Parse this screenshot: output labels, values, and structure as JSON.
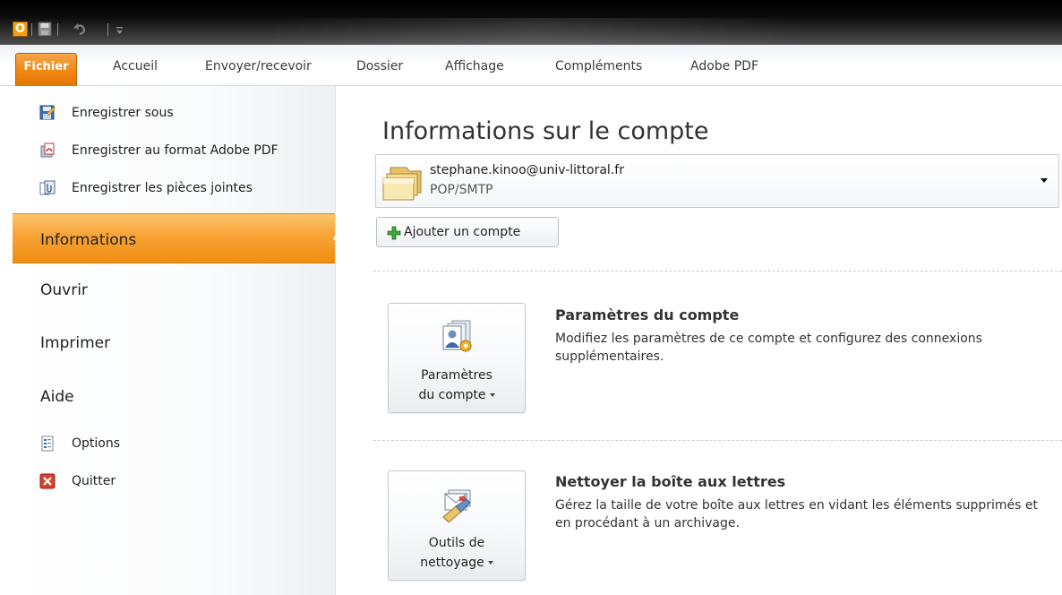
{
  "titlebar": {
    "app_icon_letter": "O",
    "qat_icons": [
      "save-icon",
      "undo-icon",
      "customize-qat-icon"
    ]
  },
  "ribbon": {
    "file_tab": "Fichier",
    "tabs": [
      "Accueil",
      "Envoyer/recevoir",
      "Dossier",
      "Affichage",
      "Compléments",
      "Adobe PDF"
    ],
    "accent_color": "#ef8a16"
  },
  "nav": {
    "commands_top": [
      {
        "label": "Enregistrer sous",
        "icon": "save-as-icon"
      },
      {
        "label": "Enregistrer au format Adobe PDF",
        "icon": "adobe-pdf-icon"
      },
      {
        "label": "Enregistrer les pièces jointes",
        "icon": "attachments-icon"
      }
    ],
    "sections": [
      "Informations",
      "Ouvrir",
      "Imprimer",
      "Aide"
    ],
    "selected_section": "Informations",
    "commands_bottom": [
      {
        "label": "Options",
        "icon": "options-icon"
      },
      {
        "label": "Quitter",
        "icon": "exit-icon"
      }
    ]
  },
  "main": {
    "title": "Informations sur le compte",
    "account": {
      "email": "stephane.kinoo@univ-littoral.fr",
      "type": "POP/SMTP"
    },
    "add_account_label": "Ajouter un compte",
    "sections": [
      {
        "button_line1": "Paramètres",
        "button_line2": "du compte",
        "title": "Paramètres du compte",
        "description": "Modifiez les paramètres de ce compte et configurez des connexions supplémentaires."
      },
      {
        "button_line1": "Outils de",
        "button_line2": "nettoyage",
        "title": "Nettoyer la boîte aux lettres",
        "description": "Gérez la taille de votre boîte aux lettres en vidant les éléments supprimés et en procédant à un archivage."
      }
    ]
  }
}
